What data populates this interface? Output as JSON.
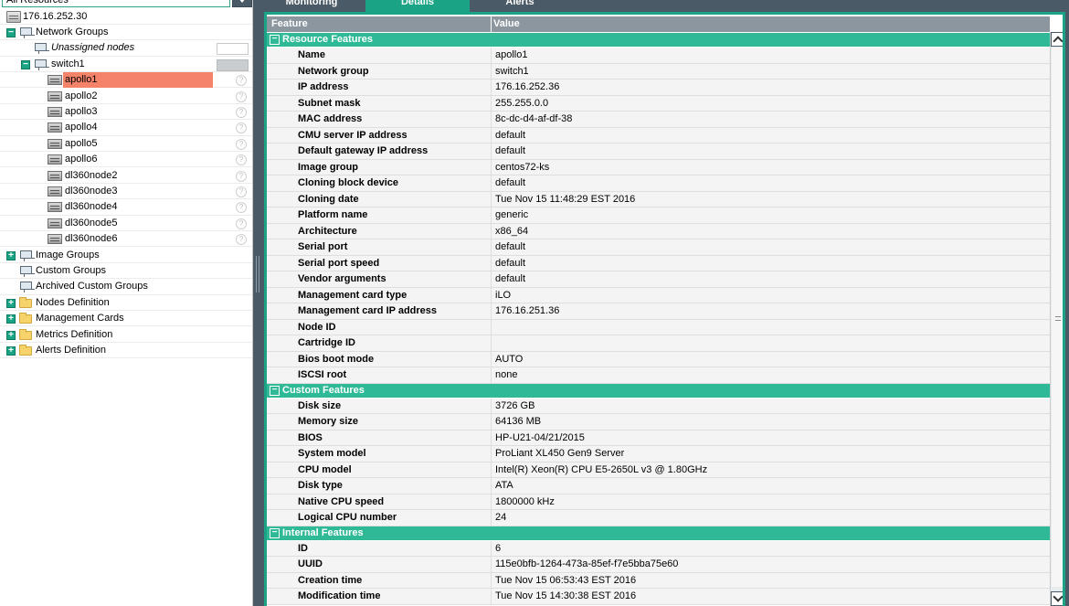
{
  "left": {
    "combo_value": "All Resources",
    "tree": [
      {
        "label": "176.16.252.30",
        "icon": "server-icon",
        "level": 0
      },
      {
        "label": "Network Groups",
        "icon": "network-icon",
        "level": 0,
        "expander": "−"
      },
      {
        "label": "Unassigned nodes",
        "icon": "network-icon",
        "level": 1,
        "italic": true
      },
      {
        "label": "switch1",
        "icon": "network-icon",
        "level": 1,
        "expander": "−"
      },
      {
        "label": "apollo1",
        "icon": "node-icon",
        "level": 2,
        "selected": true
      },
      {
        "label": "apollo2",
        "icon": "node-icon",
        "level": 2
      },
      {
        "label": "apollo3",
        "icon": "node-icon",
        "level": 2
      },
      {
        "label": "apollo4",
        "icon": "node-icon",
        "level": 2
      },
      {
        "label": "apollo5",
        "icon": "node-icon",
        "level": 2
      },
      {
        "label": "apollo6",
        "icon": "node-icon",
        "level": 2
      },
      {
        "label": "dl360node2",
        "icon": "node-icon",
        "level": 2
      },
      {
        "label": "dl360node3",
        "icon": "node-icon",
        "level": 2
      },
      {
        "label": "dl360node4",
        "icon": "node-icon",
        "level": 2
      },
      {
        "label": "dl360node5",
        "icon": "node-icon",
        "level": 2
      },
      {
        "label": "dl360node6",
        "icon": "node-icon",
        "level": 2
      },
      {
        "label": "Image Groups",
        "icon": "network-icon",
        "level": 0,
        "expander": "+"
      },
      {
        "label": "Custom Groups",
        "icon": "network-icon",
        "level": 0
      },
      {
        "label": "Archived Custom Groups",
        "icon": "network-icon",
        "level": 0
      },
      {
        "label": "Nodes Definition",
        "icon": "folder-icon",
        "level": 0,
        "expander": "+"
      },
      {
        "label": "Management Cards",
        "icon": "folder-icon",
        "level": 0,
        "expander": "+"
      },
      {
        "label": "Metrics Definition",
        "icon": "folder-icon",
        "level": 0,
        "expander": "+"
      },
      {
        "label": "Alerts Definition",
        "icon": "folder-icon",
        "level": 0,
        "expander": "+"
      }
    ]
  },
  "tabs": [
    {
      "label": "Monitoring",
      "active": false
    },
    {
      "label": "Details",
      "active": true
    },
    {
      "label": "Alerts",
      "active": false
    }
  ],
  "table": {
    "col_feature": "Feature",
    "col_value": "Value",
    "sections": [
      {
        "title": "Resource Features",
        "rows": [
          [
            "Name",
            "apollo1"
          ],
          [
            "Network group",
            "switch1"
          ],
          [
            "IP address",
            "176.16.252.36"
          ],
          [
            "Subnet mask",
            "255.255.0.0"
          ],
          [
            "MAC address",
            "8c-dc-d4-af-df-38"
          ],
          [
            "CMU server IP address",
            "default"
          ],
          [
            "Default gateway IP address",
            "default"
          ],
          [
            "Image group",
            "centos72-ks"
          ],
          [
            "Cloning block device",
            "default"
          ],
          [
            "Cloning date",
            "Tue Nov 15 11:48:29 EST 2016"
          ],
          [
            "Platform name",
            "generic"
          ],
          [
            "Architecture",
            "x86_64"
          ],
          [
            "Serial port",
            "default"
          ],
          [
            "Serial port speed",
            "default"
          ],
          [
            "Vendor arguments",
            "default"
          ],
          [
            "Management card type",
            "iLO"
          ],
          [
            "Management card IP address",
            "176.16.251.36"
          ],
          [
            "Node ID",
            ""
          ],
          [
            "Cartridge ID",
            ""
          ],
          [
            "Bios boot mode",
            "AUTO"
          ],
          [
            "ISCSI root",
            "none"
          ]
        ]
      },
      {
        "title": "Custom Features",
        "rows": [
          [
            "Disk size",
            "3726 GB"
          ],
          [
            "Memory size",
            "64136 MB"
          ],
          [
            "BIOS",
            "HP-U21-04/21/2015"
          ],
          [
            "System model",
            "ProLiant XL450 Gen9 Server"
          ],
          [
            "CPU model",
            "Intel(R) Xeon(R) CPU E5-2650L v3 @ 1.80GHz"
          ],
          [
            "Disk type",
            "ATA"
          ],
          [
            "Native CPU speed",
            "1800000 kHz"
          ],
          [
            "Logical CPU number",
            "24"
          ]
        ]
      },
      {
        "title": "Internal Features",
        "rows": [
          [
            "ID",
            "6"
          ],
          [
            "UUID",
            "115e0bfb-1264-473a-85ef-f7e5bba75e60"
          ],
          [
            "Creation time",
            "Tue Nov 15 06:53:43 EST 2016"
          ],
          [
            "Modification time",
            "Tue Nov 15 14:30:38 EST 2016"
          ]
        ]
      }
    ]
  },
  "colors": {
    "accent": "#1aa384",
    "section": "#2fb996",
    "dark": "#4a5a66",
    "selected": "#f4836a"
  }
}
